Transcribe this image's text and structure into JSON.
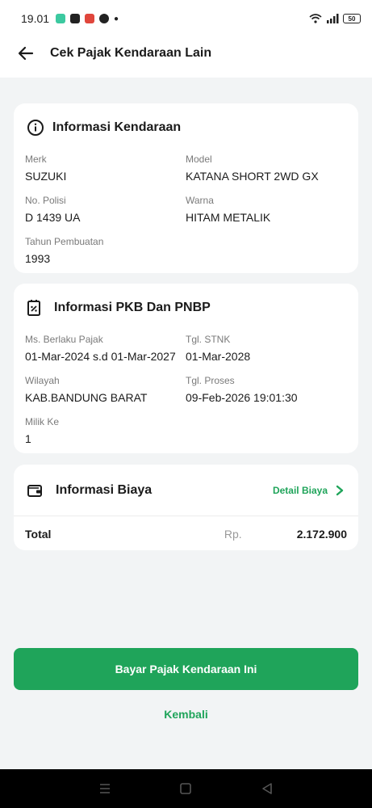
{
  "status_bar": {
    "time": "19.01",
    "battery": "50"
  },
  "app_bar": {
    "title": "Cek Pajak Kendaraan Lain"
  },
  "vehicle_info": {
    "title": "Informasi Kendaraan",
    "fields": [
      {
        "label": "Merk",
        "value": "SUZUKI"
      },
      {
        "label": "Model",
        "value": "KATANA SHORT 2WD GX"
      },
      {
        "label": "No. Polisi",
        "value": "D 1439 UA"
      },
      {
        "label": "Warna",
        "value": "HITAM METALIK"
      },
      {
        "label": "Tahun Pembuatan",
        "value": "1993"
      }
    ]
  },
  "pkb_info": {
    "title": "Informasi PKB Dan PNBP",
    "fields": [
      {
        "label": "Ms. Berlaku Pajak",
        "value": "01-Mar-2024 s.d 01-Mar-2027"
      },
      {
        "label": "Tgl. STNK",
        "value": "01-Mar-2028"
      },
      {
        "label": "Wilayah",
        "value": "KAB.BANDUNG BARAT"
      },
      {
        "label": "Tgl. Proses",
        "value": "09-Feb-2026 19:01:30"
      },
      {
        "label": "Milik Ke",
        "value": "1"
      }
    ]
  },
  "cost_info": {
    "title": "Informasi Biaya",
    "detail_label": "Detail Biaya",
    "total_label": "Total",
    "currency": "Rp.",
    "total_amount": "2.172.900"
  },
  "actions": {
    "pay_label": "Bayar Pajak Kendaraan Ini",
    "back_label": "Kembali"
  },
  "colors": {
    "accent": "#1fa45a",
    "background": "#f2f4f5"
  }
}
